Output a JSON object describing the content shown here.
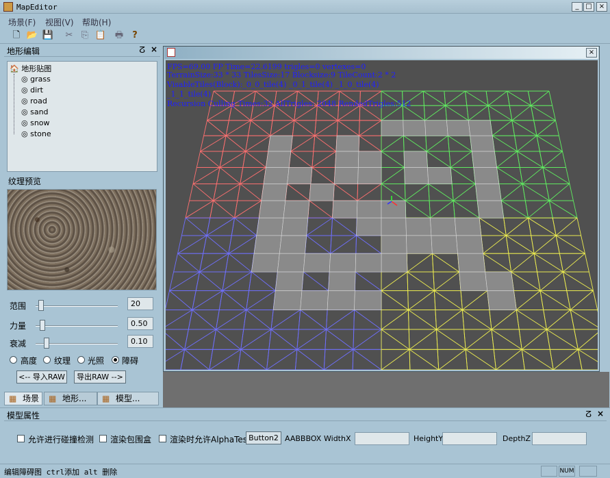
{
  "window": {
    "title": "MapEditor"
  },
  "menu": [
    "场景(F)",
    "视图(V)",
    "帮助(H)"
  ],
  "left_panel": {
    "title": "地形编辑",
    "tree_root": "地形贴图",
    "textures": [
      "grass",
      "dirt",
      "road",
      "sand",
      "snow",
      "stone"
    ],
    "preview_label": "纹理预览",
    "sliders": [
      {
        "label": "范围",
        "value": "20"
      },
      {
        "label": "力量",
        "value": "0.50"
      },
      {
        "label": "衰减",
        "value": "0.10"
      }
    ],
    "modes": [
      {
        "label": "高度",
        "selected": false
      },
      {
        "label": "纹理",
        "selected": false
      },
      {
        "label": "光照",
        "selected": false
      },
      {
        "label": "障碍",
        "selected": true
      }
    ],
    "import_label": "<-- 导入RAW",
    "export_label": "导出RAW -->",
    "tabs": [
      "场景",
      "地形...",
      "模型..."
    ]
  },
  "viewport": {
    "hud": [
      "FPS=69.00   FP Time=22.6199  trigles=0   vertexes=0",
      " TerrainSize:33 * 33  TilesSize:17  Blocksize:9  TileCount:2 * 2",
      " VisableTiles(Block):_0_0_tile(4)  _0_1_tile(4)  _1_0_tile(4)",
      "           _1_1_tile(4)",
      " Recursion Culling Times:32   AllTrigles: 2048  RendedTrigles:512"
    ]
  },
  "model_panel": {
    "title": "模型属性",
    "cb_collision": "允许进行碰撞检测",
    "cb_bbox": "渲染包围盒",
    "cb_alpha": "渲染时允许AlphaTest",
    "button2": "Button2",
    "aabbbox": "AABBBOX",
    "width_label": "WidthX",
    "height_label": "HeightY",
    "depth_label": "DepthZ"
  },
  "status": {
    "text": "编辑障碍图 ctrl添加 alt 删除",
    "num": "NUM"
  }
}
